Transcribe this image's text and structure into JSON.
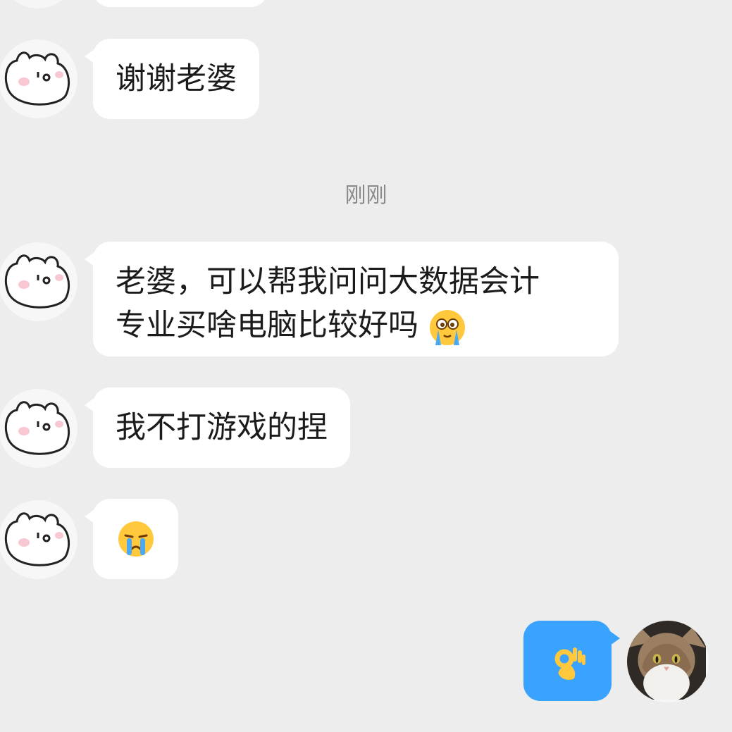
{
  "timestamp": "刚刚",
  "messages": [
    {
      "side": "left",
      "text": "谢谢老婆"
    },
    {
      "side": "left",
      "lines": [
        "老婆，可以帮我问问大数据会计",
        "专业买啥电脑比较好吗"
      ],
      "emoji": "loudly-crying-face-icon"
    },
    {
      "side": "left",
      "text": "我不打游戏的捏"
    },
    {
      "side": "left",
      "emoji": "crying-face-icon"
    },
    {
      "side": "right",
      "emoji": "ok-hand-icon"
    }
  ],
  "colors": {
    "background": "#ededed",
    "incoming_bubble": "#ffffff",
    "outgoing_bubble": "#3aa3ff"
  }
}
